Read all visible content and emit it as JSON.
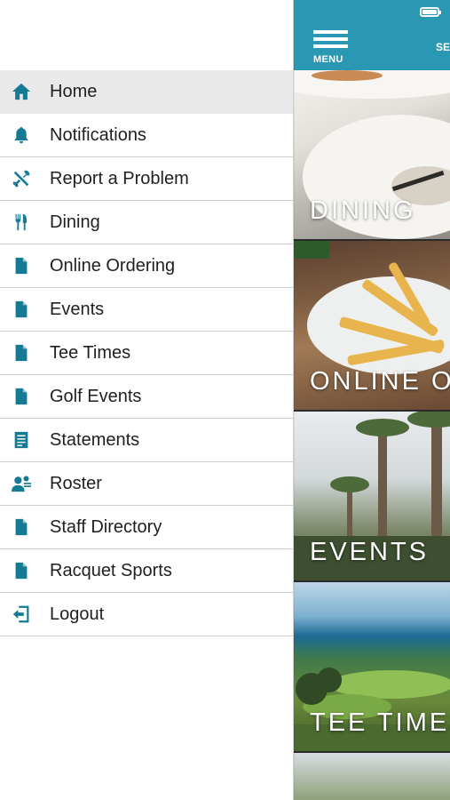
{
  "header": {
    "menu_label": "MENU",
    "right_label": "SE"
  },
  "drawer": {
    "items": [
      {
        "label": "Home",
        "icon": "home-icon"
      },
      {
        "label": "Notifications",
        "icon": "bell-icon"
      },
      {
        "label": "Report a Problem",
        "icon": "tools-icon"
      },
      {
        "label": "Dining",
        "icon": "fork-knife-icon"
      },
      {
        "label": "Online Ordering",
        "icon": "document-icon"
      },
      {
        "label": "Events",
        "icon": "document-icon"
      },
      {
        "label": "Tee Times",
        "icon": "document-icon"
      },
      {
        "label": "Golf Events",
        "icon": "document-icon"
      },
      {
        "label": "Statements",
        "icon": "statement-icon"
      },
      {
        "label": "Roster",
        "icon": "roster-icon"
      },
      {
        "label": "Staff Directory",
        "icon": "document-icon"
      },
      {
        "label": "Racquet Sports",
        "icon": "document-icon"
      },
      {
        "label": "Logout",
        "icon": "logout-icon"
      }
    ],
    "active_index": 0
  },
  "tiles": [
    {
      "title": "DINING"
    },
    {
      "title": "ONLINE OR"
    },
    {
      "title": "EVENTS"
    },
    {
      "title": "TEE TIMES"
    }
  ],
  "colors": {
    "accent": "#2a97b3",
    "icon": "#157a94",
    "active_row": "#e9e9e9"
  }
}
